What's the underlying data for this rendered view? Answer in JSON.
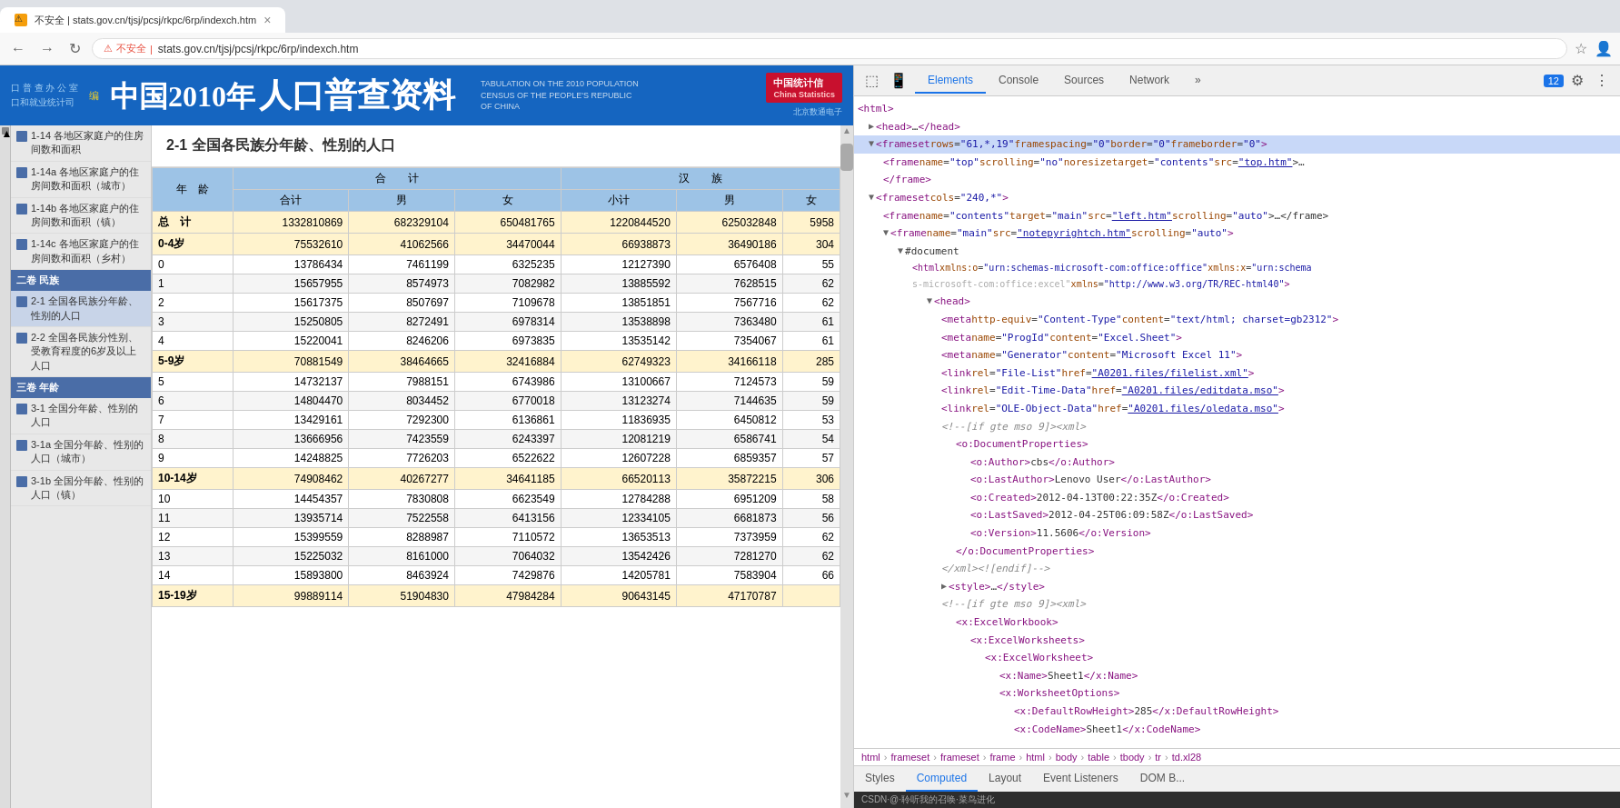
{
  "browser": {
    "tab_label": "不安全 | stats.gov.cn/tjsj/pcsj/rkpc/6rp/indexch.htm",
    "address_bar": {
      "security": "不安全",
      "url": "stats.gov.cn/tjsj/pcsj/rkpc/6rp/indexch.htm"
    },
    "actions": [
      "bookmark",
      "profile"
    ]
  },
  "website": {
    "header": {
      "title_zh": "中国2010年",
      "subtitle_zh": "人口普查资料",
      "title_en": "TABULATION ON THE 2010 POPULATION CENSUS OF THE PEOPLE'S REPUBLIC OF CHINA",
      "logo_text": "中国统计信",
      "logo_sub": "China Statistics"
    },
    "left_nav": {
      "sections": [
        {
          "label": "",
          "items": [
            {
              "text": "1-14 各地区家庭户的住房间数和面积",
              "active": false
            },
            {
              "text": "1-14a 各地区家庭户的住房间数和面积（城市）",
              "active": false
            },
            {
              "text": "1-14b 各地区家庭户的住房间数和面积（镇）",
              "active": false
            },
            {
              "text": "1-14c 各地区家庭户的住房间数和面积（乡村）",
              "active": false
            }
          ]
        },
        {
          "label": "二卷 民族",
          "items": [
            {
              "text": "2-1 全国各民族分年龄、性别的人口",
              "active": true
            },
            {
              "text": "2-2 全国各民族分性别、受教育程度的6岁及以上人口",
              "active": false
            }
          ]
        },
        {
          "label": "三卷 年龄",
          "items": [
            {
              "text": "3-1 全国分年龄、性别的人口",
              "active": false
            },
            {
              "text": "3-1a 全国分年龄、性别的人口（城市）",
              "active": false
            },
            {
              "text": "3-1b 全国分年龄、性别的人口（镇）",
              "active": false
            }
          ]
        }
      ]
    },
    "content": {
      "title": "2-1 全国各民族分年龄、性别的人口",
      "table": {
        "headers_row1": [
          "年  龄",
          "合　　计",
          "",
          "",
          "汉　　族",
          "",
          ""
        ],
        "headers_row2": [
          "",
          "合计",
          "男",
          "女",
          "小计",
          "男",
          "女"
        ],
        "rows": [
          {
            "age": "总　计",
            "total": "1332810869",
            "male": "682329104",
            "female": "650481765",
            "han_total": "1220844520",
            "han_male": "625032848",
            "han_female": "5958"
          },
          {
            "age": "0-4岁",
            "total": "75532610",
            "male": "41062566",
            "female": "34470044",
            "han_total": "66938873",
            "han_male": "36490186",
            "han_female": "304"
          },
          {
            "age": "0",
            "total": "13786434",
            "male": "7461199",
            "female": "6325235",
            "han_total": "12127390",
            "han_male": "6576408",
            "han_female": "55"
          },
          {
            "age": "1",
            "total": "15657955",
            "male": "8574973",
            "female": "7082982",
            "han_total": "13885592",
            "han_male": "7628515",
            "han_female": "62"
          },
          {
            "age": "2",
            "total": "15617375",
            "male": "8507697",
            "female": "7109678",
            "han_total": "13851851",
            "han_male": "7567716",
            "han_female": "62"
          },
          {
            "age": "3",
            "total": "15250805",
            "male": "8272491",
            "female": "6978314",
            "han_total": "13538898",
            "han_male": "7363480",
            "han_female": "61"
          },
          {
            "age": "4",
            "total": "15220041",
            "male": "8246206",
            "female": "6973835",
            "han_total": "13535142",
            "han_male": "7354067",
            "han_female": "61"
          },
          {
            "age": "5-9岁",
            "total": "70881549",
            "male": "38464665",
            "female": "32416884",
            "han_total": "62749323",
            "han_male": "34166118",
            "han_female": "285"
          },
          {
            "age": "5",
            "total": "14732137",
            "male": "7988151",
            "female": "6743986",
            "han_total": "13100667",
            "han_male": "7124573",
            "han_female": "59"
          },
          {
            "age": "6",
            "total": "14804470",
            "male": "8034452",
            "female": "6770018",
            "han_total": "13123274",
            "han_male": "7144635",
            "han_female": "59"
          },
          {
            "age": "7",
            "total": "13429161",
            "male": "7292300",
            "female": "6136861",
            "han_total": "11836935",
            "han_male": "6450812",
            "han_female": "53"
          },
          {
            "age": "8",
            "total": "13666956",
            "male": "7423559",
            "female": "6243397",
            "han_total": "12081219",
            "han_male": "6586741",
            "han_female": "54"
          },
          {
            "age": "9",
            "total": "14248825",
            "male": "7726203",
            "female": "6522622",
            "han_total": "12607228",
            "han_male": "6859357",
            "han_female": "57"
          },
          {
            "age": "10-14岁",
            "total": "74908462",
            "male": "40267277",
            "female": "34641185",
            "han_total": "66520113",
            "han_male": "35872215",
            "han_female": "306"
          },
          {
            "age": "10",
            "total": "14454357",
            "male": "7830808",
            "female": "6623549",
            "han_total": "12784288",
            "han_male": "6951209",
            "han_female": "58"
          },
          {
            "age": "11",
            "total": "13935714",
            "male": "7522558",
            "female": "6413156",
            "han_total": "12334105",
            "han_male": "6681873",
            "han_female": "56"
          },
          {
            "age": "12",
            "total": "15399559",
            "male": "8288987",
            "female": "7110572",
            "han_total": "13653513",
            "han_male": "7373959",
            "han_female": "62"
          },
          {
            "age": "13",
            "total": "15225032",
            "male": "8161000",
            "female": "7064032",
            "han_total": "13542426",
            "han_male": "7281270",
            "han_female": "62"
          },
          {
            "age": "14",
            "total": "15893800",
            "male": "8463924",
            "female": "7429876",
            "han_total": "14205781",
            "han_male": "7583904",
            "han_female": "66"
          },
          {
            "age": "15-19岁",
            "total": "99889114",
            "male": "51904830",
            "female": "47984284",
            "han_total": "90643145",
            "han_male": "47170787",
            "han_female": ""
          }
        ]
      }
    }
  },
  "devtools": {
    "toolbar": {
      "inspect_label": "Inspect",
      "badge_count": "12"
    },
    "tabs": [
      "Elements",
      "Console",
      "Sources",
      "Network",
      "»"
    ],
    "active_tab": "Elements",
    "html_tree": [
      {
        "indent": 0,
        "content": "<html>",
        "type": "tag",
        "expanded": true
      },
      {
        "indent": 1,
        "content": "▶ <head>…</head>",
        "type": "tag-collapsed"
      },
      {
        "indent": 1,
        "content": "▼ <frameset rows=\"61,*,19\" framespacing=\"0\" border=\"0\" frameborder=\"0\">",
        "type": "tag",
        "expanded": true
      },
      {
        "indent": 2,
        "content": "<frame name=\"top\" scrolling=\"no\" noresize target=\"contents\" src=\"top.htm\">…",
        "type": "tag",
        "has_link": true
      },
      {
        "indent": 2,
        "content": "</frame>",
        "type": "tag-close"
      },
      {
        "indent": 1,
        "content": "▼ <frameset cols=\"240,*\">",
        "type": "tag",
        "expanded": true
      },
      {
        "indent": 2,
        "content": "<frame name=\"contents\" target=\"main\" src=\"left.htm\" scrolling=\"auto\">…</frame>",
        "type": "tag",
        "has_link": true
      },
      {
        "indent": 2,
        "content": "▼ <frame name=\"main\" src=\"notepyrightch.htm\" scrolling=\"auto\">",
        "type": "tag",
        "expanded": true
      },
      {
        "indent": 3,
        "content": "▼ #document",
        "type": "tag",
        "expanded": true
      },
      {
        "indent": 4,
        "content": "<html xmlns:o=\"urn:schemas-microsoft-com:office:office\" xmlns:x=\"urn:schemas-microsoft-com:office:excel\" xmlns=\"http://www.w3.org/TR/REC-html40\">",
        "type": "tag"
      },
      {
        "indent": 5,
        "content": "▼ <head>",
        "type": "tag",
        "expanded": true
      },
      {
        "indent": 6,
        "content": "<meta http-equiv=\"Content-Type\" content=\"text/html; charset=gb2312\">",
        "type": "tag"
      },
      {
        "indent": 6,
        "content": "<meta name=\"ProgId\" content=\"Excel.Sheet\">",
        "type": "tag"
      },
      {
        "indent": 6,
        "content": "<meta name=\"Generator\" content=\"Microsoft Excel 11\">",
        "type": "tag"
      },
      {
        "indent": 6,
        "content": "<link rel=\"File-List\" href=\"A0201.files/filelist.xml\">",
        "type": "tag",
        "has_link": true
      },
      {
        "indent": 6,
        "content": "<link rel=\"Edit-Time-Data\" href=\"A0201.files/editdata.mso\">",
        "type": "tag",
        "has_link": true
      },
      {
        "indent": 6,
        "content": "<link rel=\"OLE-Object-Data\" href=\"A0201.files/oledata.mso\">",
        "type": "tag",
        "has_link": true
      },
      {
        "indent": 6,
        "content": "<!--[if gte mso 9]><xml>",
        "type": "comment"
      },
      {
        "indent": 7,
        "content": "<o:DocumentProperties>",
        "type": "tag"
      },
      {
        "indent": 8,
        "content": "<o:Author>cbs</o:Author>",
        "type": "tag"
      },
      {
        "indent": 8,
        "content": "<o:LastAuthor>Lenovo User</o:LastAuthor>",
        "type": "tag"
      },
      {
        "indent": 8,
        "content": "<o:Created>2012-04-13T00:22:35Z</o:Created>",
        "type": "tag"
      },
      {
        "indent": 8,
        "content": "<o:LastSaved>2012-04-25T06:09:58Z</o:LastSaved>",
        "type": "tag"
      },
      {
        "indent": 8,
        "content": "<o:Version>11.5606</o:Version>",
        "type": "tag"
      },
      {
        "indent": 7,
        "content": "</o:DocumentProperties>",
        "type": "tag-close"
      },
      {
        "indent": 6,
        "content": "</xml><![endif]-->",
        "type": "comment"
      },
      {
        "indent": 6,
        "content": "▶ <style>…</style>",
        "type": "tag-collapsed"
      },
      {
        "indent": 6,
        "content": "<!--[if gte mso 9]><xml>",
        "type": "comment"
      },
      {
        "indent": 7,
        "content": "<x:ExcelWorkbook>",
        "type": "tag"
      },
      {
        "indent": 8,
        "content": "<x:ExcelWorksheets>",
        "type": "tag"
      },
      {
        "indent": 9,
        "content": "<x:ExcelWorksheet>",
        "type": "tag"
      },
      {
        "indent": 10,
        "content": "<x:Name>Sheet1</x:Name>",
        "type": "tag"
      },
      {
        "indent": 10,
        "content": "<x:WorksheetOptions>",
        "type": "tag"
      },
      {
        "indent": 11,
        "content": "<x:DefaultRowHeight>285</x:DefaultRowHeight>",
        "type": "tag"
      },
      {
        "indent": 11,
        "content": "<x:CodeName>Sheet1</x:CodeName>",
        "type": "tag"
      }
    ],
    "breadcrumb": [
      "html",
      "frameset",
      "frameset",
      "frame",
      "html",
      "body",
      "table",
      "tbody",
      "tr",
      "td.xl28"
    ],
    "bottom_tabs": [
      "Styles",
      "Computed",
      "Layout",
      "Event Listeners",
      "DOM B..."
    ],
    "active_bottom_tab": "Computed",
    "csdn_text": "CSDN·@·聆听我的召唤·菜鸟进化"
  }
}
